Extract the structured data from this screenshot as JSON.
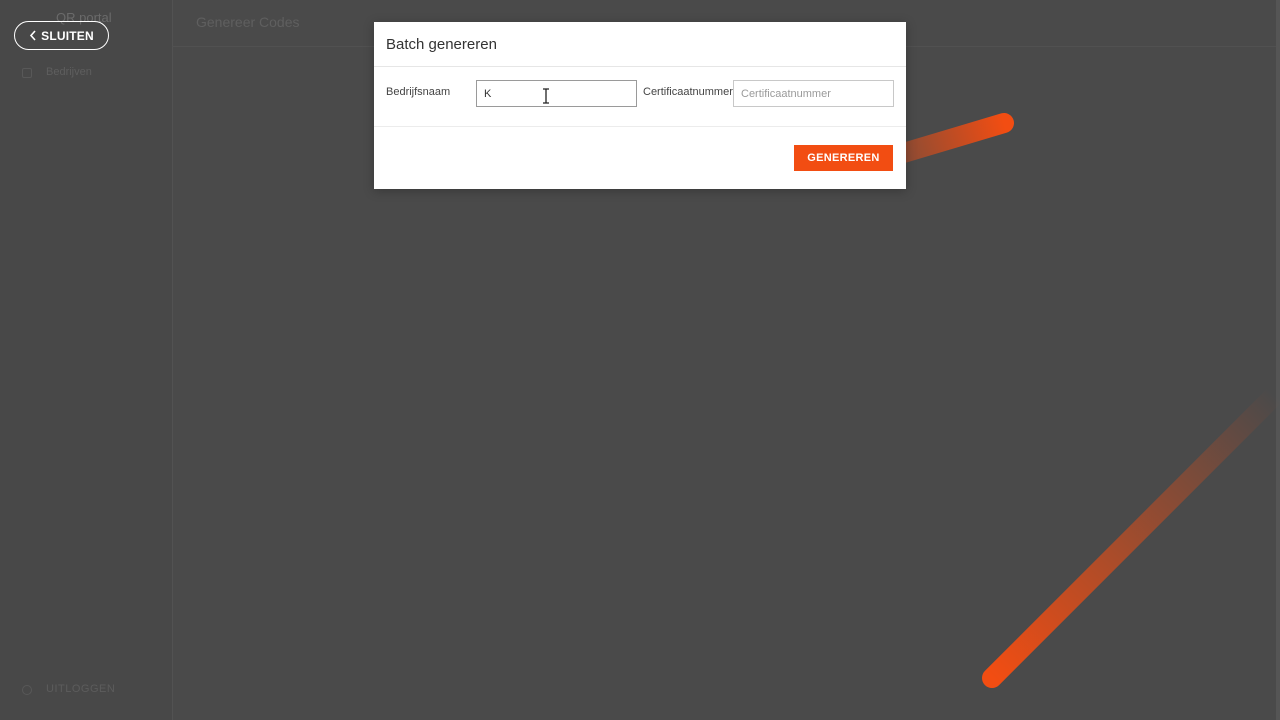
{
  "background": {
    "brand_text": "QR portal",
    "nav_item": "Bedrijven",
    "header_title": "Genereer Codes",
    "logout_text": "UITLOGGEN"
  },
  "close_button": {
    "label": "SLUITEN",
    "icon": "chevron-left-icon"
  },
  "modal": {
    "title": "Batch genereren",
    "fields": {
      "company": {
        "label": "Bedrijfsnaam",
        "value": "K",
        "placeholder": ""
      },
      "certificate": {
        "label": "Certificaatnummer",
        "value": "",
        "placeholder": "Certificaatnummer"
      }
    },
    "submit_label": "GENEREREN"
  },
  "colors": {
    "accent": "#f24d12",
    "overlay": "#4a4a4a",
    "modal_bg": "#ffffff"
  }
}
